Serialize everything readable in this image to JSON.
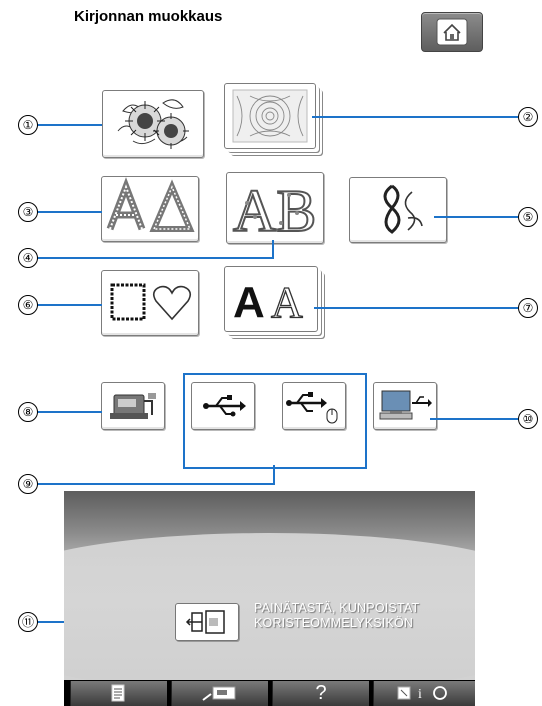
{
  "header": {
    "title": "Kirjonnan muokkaus",
    "home_icon": "home-icon"
  },
  "tiles": [
    {
      "name": "embroidery-patterns-tile",
      "icon": "sunflower-pattern-icon",
      "callout": "①"
    },
    {
      "name": "pattern-pack-tile",
      "icon": "lace-pattern-icon",
      "callout": "②"
    },
    {
      "name": "alphabet-tile",
      "icon": "alphabet-aa-icon",
      "callout": "③"
    },
    {
      "name": "decorative-alphabet-tile",
      "icon": "floral-ab-icon",
      "callout": "④"
    },
    {
      "name": "utility-patterns-tile",
      "icon": "swirl-icon",
      "callout": "⑤"
    },
    {
      "name": "frame-patterns-tile",
      "icon": "frame-heart-icon",
      "callout": "⑥"
    },
    {
      "name": "font-card-tile",
      "icon": "font-aa-icon",
      "callout": "⑦"
    },
    {
      "name": "machine-memory-tile",
      "icon": "machine-memory-icon",
      "callout": "⑧"
    },
    {
      "name": "usb-media-tile",
      "icon": "usb-icon",
      "callout": "⑨"
    },
    {
      "name": "usb-mouse-tile",
      "icon": "usb-mouse-icon",
      "callout": "⑨"
    },
    {
      "name": "computer-usb-tile",
      "icon": "computer-usb-icon",
      "callout": "⑩"
    }
  ],
  "callouts": {
    "c1": "①",
    "c2": "②",
    "c3": "③",
    "c4": "④",
    "c5": "⑤",
    "c6": "⑥",
    "c7": "⑦",
    "c8": "⑧",
    "c9": "⑨",
    "c10": "⑩",
    "c11": "⑪"
  },
  "bottom": {
    "message_line1": "PAINÄTASTÄ, KUNPOISTAT",
    "message_line2": "KORISTEOMMELYKSIKÖN",
    "delete_icon": "remove-unit-icon"
  },
  "toolbar": {
    "buttons": [
      {
        "icon": "manual-icon",
        "label": ""
      },
      {
        "icon": "machine-setting-icon",
        "label": ""
      },
      {
        "icon": "help-icon",
        "label": "?"
      },
      {
        "icon": "info-rotate-icon",
        "label": ""
      }
    ]
  },
  "colors": {
    "callout_line": "#1d73c9",
    "panel_dark": "#5d5d5d",
    "toolbar": "#000000"
  }
}
